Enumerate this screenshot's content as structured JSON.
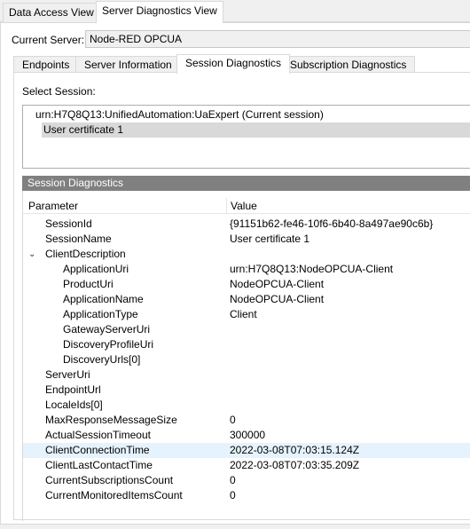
{
  "outer_tabs": [
    "Data Access View",
    "Server Diagnostics View"
  ],
  "current_server_label": "Current Server:",
  "current_server_value": "Node-RED OPCUA",
  "inner_tabs": [
    "Endpoints",
    "Server Information",
    "Session Diagnostics",
    "Subscription Diagnostics"
  ],
  "select_session_label": "Select Session:",
  "sessions": [
    "urn:H7Q8Q13:UnifiedAutomation:UaExpert (Current session)",
    "User certificate  1"
  ],
  "group_header": "Session Diagnostics",
  "columns": {
    "parameter": "Parameter",
    "value": "Value"
  },
  "rows": [
    {
      "param": "SessionId",
      "value": "{91151b62-fe46-10f6-6b40-8a497ae90c6b}"
    },
    {
      "param": "SessionName",
      "value": "User certificate  1"
    },
    {
      "param": "ClientDescription",
      "value": "",
      "expand_icon": "chevron-down-icon",
      "expand_glyph": "⌄"
    },
    {
      "param": "ApplicationUri",
      "value": "urn:H7Q8Q13:NodeOPCUA-Client"
    },
    {
      "param": "ProductUri",
      "value": "NodeOPCUA-Client"
    },
    {
      "param": "ApplicationName",
      "value": "NodeOPCUA-Client"
    },
    {
      "param": "ApplicationType",
      "value": "Client"
    },
    {
      "param": "GatewayServerUri",
      "value": ""
    },
    {
      "param": "DiscoveryProfileUri",
      "value": ""
    },
    {
      "param": "DiscoveryUrls[0]",
      "value": ""
    },
    {
      "param": "ServerUri",
      "value": ""
    },
    {
      "param": "EndpointUrl",
      "value": ""
    },
    {
      "param": "LocaleIds[0]",
      "value": ""
    },
    {
      "param": "MaxResponseMessageSize",
      "value": "0"
    },
    {
      "param": "ActualSessionTimeout",
      "value": "300000"
    },
    {
      "param": "ClientConnectionTime",
      "value": "2022-03-08T07:03:15.124Z"
    },
    {
      "param": "ClientLastContactTime",
      "value": "2022-03-08T07:03:35.209Z"
    },
    {
      "param": "CurrentSubscriptionsCount",
      "value": "0"
    },
    {
      "param": "CurrentMonitoredItemsCount",
      "value": "0"
    }
  ],
  "colors": {
    "selected_session_bg": "#d9d9d9",
    "group_header_bg": "#808080",
    "highlight_row_bg": "#e5f3ff"
  }
}
